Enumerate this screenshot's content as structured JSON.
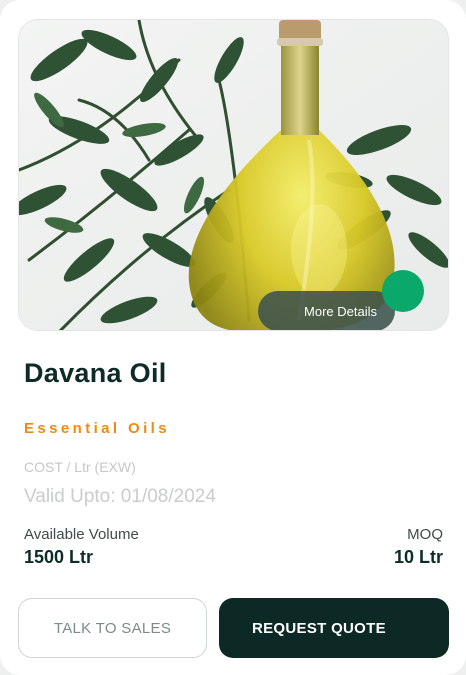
{
  "product": {
    "title": "Davana Oil",
    "category": "Essential Oils",
    "cost_label": "COST / Ltr (EXW)",
    "valid_upto": "Valid Upto: 01/08/2024",
    "available_volume_label": "Available Volume",
    "available_volume_value": "1500 Ltr",
    "moq_label": "MOQ",
    "moq_value": "10 Ltr"
  },
  "media": {
    "more_details_label": "More Details",
    "image_icon": "product-photo-davana-oil"
  },
  "actions": {
    "talk_to_sales_label": "TALK TO SALES",
    "request_quote_label": "REQUEST QUOTE"
  },
  "colors": {
    "accent": "#f08a14",
    "brand_dark": "#0d2925",
    "status_green": "#0aa86a"
  }
}
